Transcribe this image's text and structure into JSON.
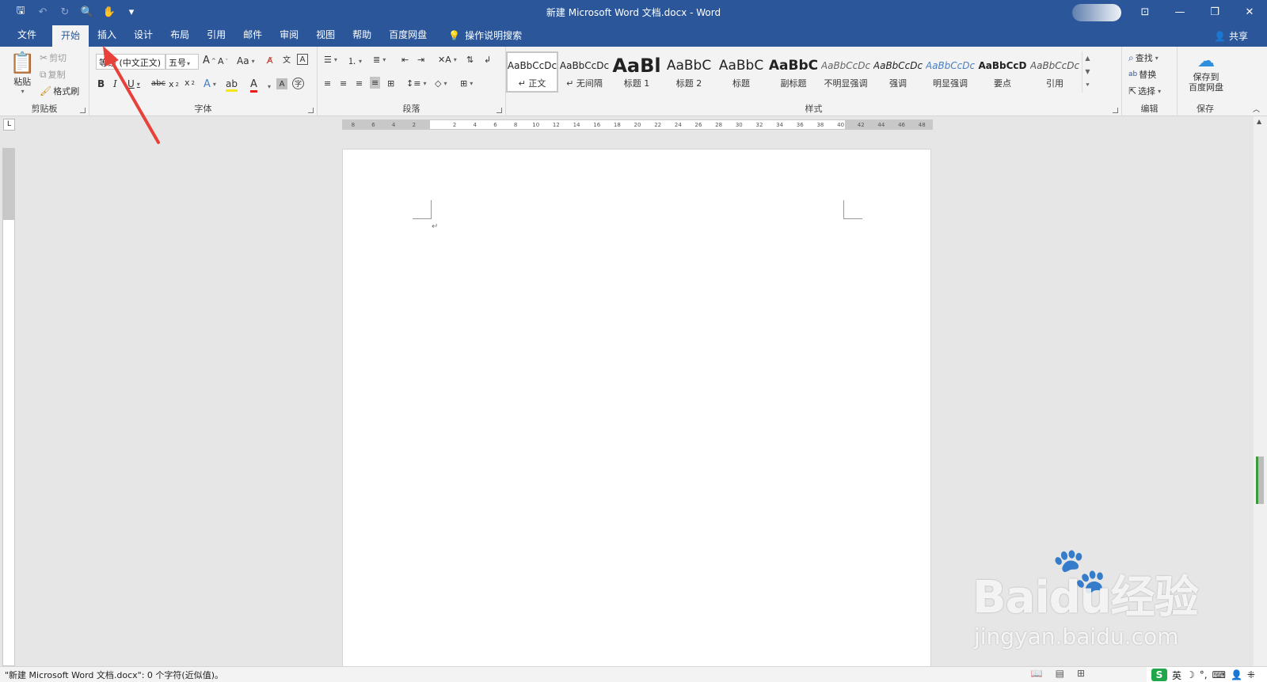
{
  "titlebar": {
    "title": "新建 Microsoft Word 文档.docx  -  Word",
    "qat": [
      {
        "name": "save-icon",
        "glyph": "🖫"
      },
      {
        "name": "undo-icon",
        "glyph": "↶"
      },
      {
        "name": "redo-icon",
        "glyph": "↻"
      },
      {
        "name": "print-preview-icon",
        "glyph": "🔍"
      },
      {
        "name": "touch-mode-icon",
        "glyph": "✋"
      },
      {
        "name": "customize-qat-icon",
        "glyph": "▾"
      }
    ],
    "window_controls": [
      {
        "name": "ribbon-display-options-icon",
        "glyph": "⊡"
      },
      {
        "name": "minimize-icon",
        "glyph": "—"
      },
      {
        "name": "restore-icon",
        "glyph": "❐"
      },
      {
        "name": "close-icon",
        "glyph": "✕"
      }
    ]
  },
  "tabs": [
    "文件",
    "开始",
    "插入",
    "设计",
    "布局",
    "引用",
    "邮件",
    "审阅",
    "视图",
    "帮助",
    "百度网盘"
  ],
  "active_tab": "开始",
  "tell_me": "操作说明搜索",
  "share": "共享",
  "clipboard": {
    "paste": "粘贴",
    "cut": "剪切",
    "copy": "复制",
    "format_painter": "格式刷",
    "label": "剪贴板"
  },
  "font": {
    "font_name": "等线 (中文正文)",
    "font_size": "五号",
    "label": "字体",
    "change_case": "Aa"
  },
  "paragraph": {
    "label": "段落"
  },
  "styles": {
    "label": "样式",
    "items": [
      {
        "sample": "AaBbCcDc",
        "name": "↵ 正文"
      },
      {
        "sample": "AaBbCcDc",
        "name": "↵ 无间隔"
      },
      {
        "sample": "AaBl",
        "name": "标题 1"
      },
      {
        "sample": "AaBbC",
        "name": "标题 2"
      },
      {
        "sample": "AaBbC",
        "name": "标题"
      },
      {
        "sample": "AaBbC",
        "name": "副标题"
      },
      {
        "sample": "AaBbCcDc",
        "name": "不明显强调"
      },
      {
        "sample": "AaBbCcDc",
        "name": "强调"
      },
      {
        "sample": "AaBbCcDc",
        "name": "明显强调"
      },
      {
        "sample": "AaBbCcD",
        "name": "要点"
      },
      {
        "sample": "AaBbCcDc",
        "name": "引用"
      }
    ]
  },
  "editing": {
    "find": "查找",
    "replace": "替换",
    "select": "选择",
    "label": "编辑"
  },
  "save": {
    "button": "保存到\n百度网盘",
    "label": "保存"
  },
  "ruler_numbers": [
    "8",
    "6",
    "4",
    "2",
    "",
    "2",
    "4",
    "6",
    "8",
    "10",
    "12",
    "14",
    "16",
    "18",
    "20",
    "22",
    "24",
    "26",
    "28",
    "30",
    "32",
    "34",
    "36",
    "38",
    "40",
    "42",
    "44",
    "46",
    "48"
  ],
  "status": {
    "text": "\"新建 Microsoft Word 文档.docx\": 0 个字符(近似值)。"
  },
  "ime": {
    "logo": "S",
    "lang": "英"
  },
  "watermark": {
    "main": "Baidu经验",
    "sub": "jingyan.baidu.com"
  },
  "colors": {
    "accent": "#2b579a",
    "arrow": "#e8413a"
  }
}
